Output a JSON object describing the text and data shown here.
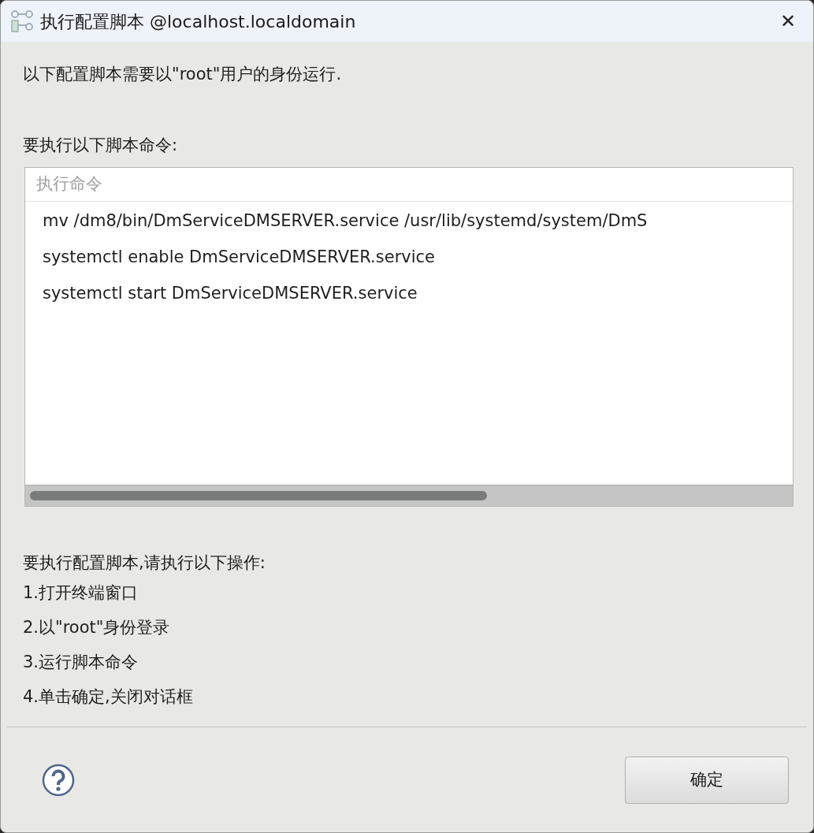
{
  "window": {
    "title": "执行配置脚本 @localhost.localdomain",
    "close": "✕"
  },
  "intro": "以下配置脚本需要以\"root\"用户的身份运行.",
  "commands_label": "要执行以下脚本命令:",
  "table": {
    "columns": [
      "执行命令"
    ],
    "rows": [
      {
        "command": "mv /dm8/bin/DmServiceDMSERVER.service /usr/lib/systemd/system/DmS"
      },
      {
        "command": "systemctl enable DmServiceDMSERVER.service"
      },
      {
        "command": "systemctl start DmServiceDMSERVER.service"
      }
    ]
  },
  "steps_label": "要执行配置脚本,请执行以下操作:",
  "steps": [
    "1.打开终端窗口",
    "2.以\"root\"身份登录",
    "3.运行脚本命令",
    "4.单击确定,关闭对话框"
  ],
  "buttons": [
    "确定"
  ]
}
